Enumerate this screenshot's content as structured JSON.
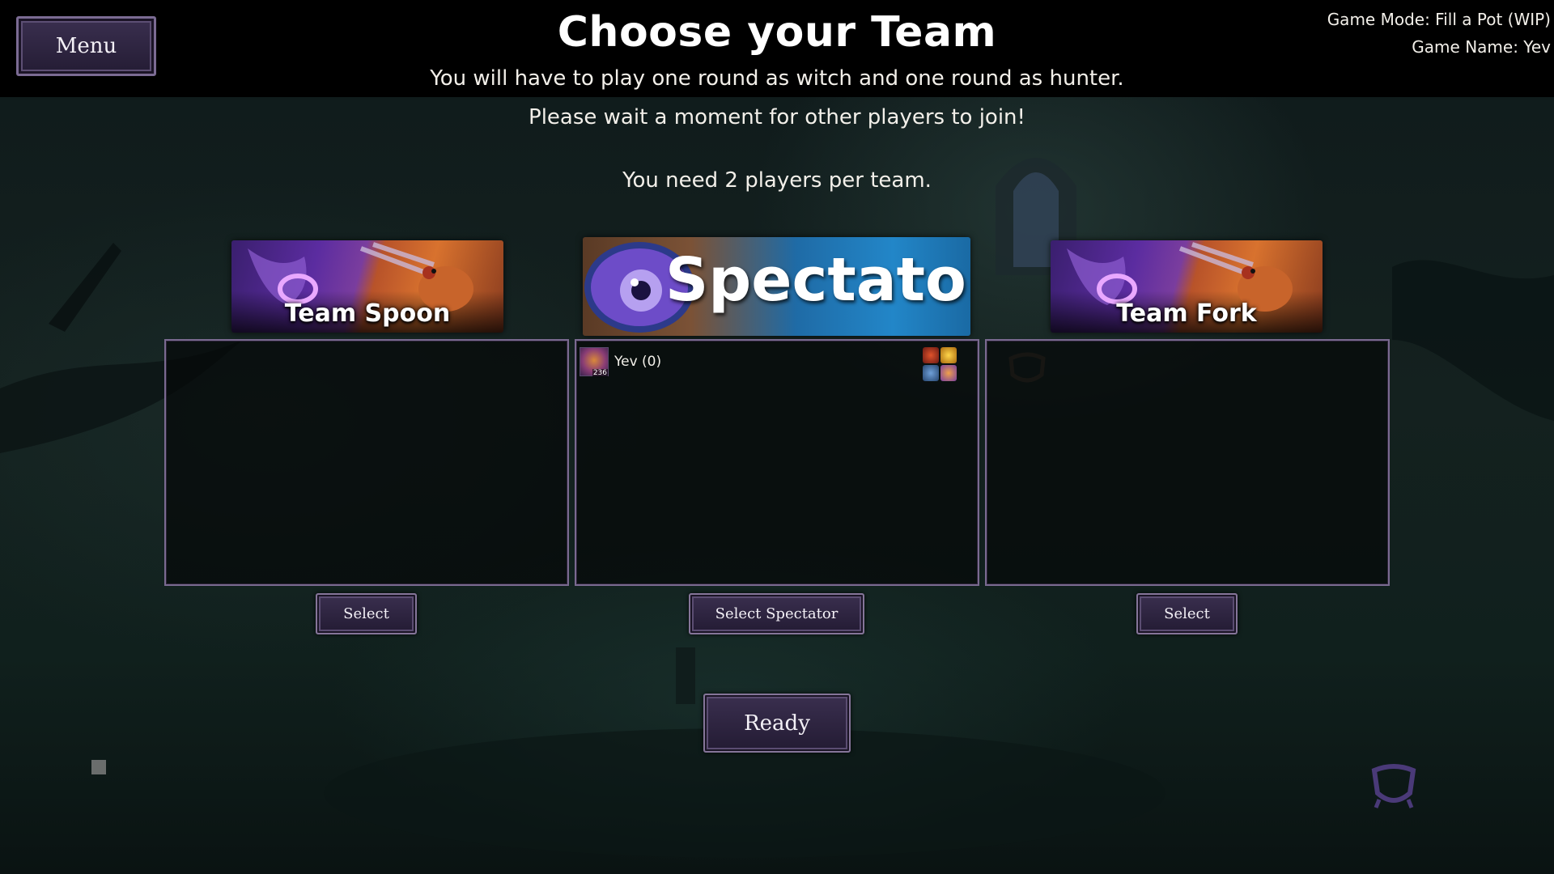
{
  "header": {
    "menu_label": "Menu",
    "title": "Choose your Team",
    "subtitle_1": "You will have to play one round as witch and one round as hunter.",
    "subtitle_2": "Please wait a moment for other players to join!",
    "players_needed": "You need 2 players per team.",
    "game_mode": "Game Mode: Fill a Pot (WIP)",
    "game_name": "Game Name: Yev"
  },
  "teams": [
    {
      "name": "Team Spoon",
      "button": "Select",
      "players": []
    },
    {
      "name": "Spectators",
      "button": "Select Spectator",
      "players": [
        {
          "name": "Yev (0)",
          "level": "236",
          "badge_icons": [
            "red-flame-badge-icon",
            "gold-star-badge-icon",
            "blue-creature-badge-icon",
            "orange-potion-badge-icon"
          ]
        }
      ]
    },
    {
      "name": "Team Fork",
      "button": "Select",
      "players": []
    }
  ],
  "footer": {
    "ready_label": "Ready"
  },
  "colors": {
    "panel_border": "#7a6a90",
    "button_bg": "#2e2540",
    "spectator_banner_blue": "#2286c8",
    "team_banner_purple": "#5b2ca0",
    "team_banner_orange": "#d8722e"
  }
}
